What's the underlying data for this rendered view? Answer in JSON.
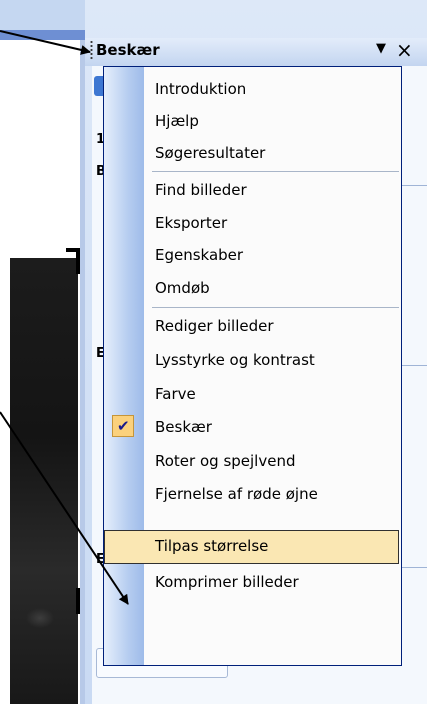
{
  "pane": {
    "title": "Beskær",
    "dropdown_icon": "dropdown-triangle-icon",
    "close_icon": "close-icon",
    "close_glyph": "×",
    "dropdown_glyph": "▼",
    "stub_letters": [
      "1",
      "B",
      "E",
      "E"
    ]
  },
  "menu": {
    "items": [
      {
        "label": "Introduktion",
        "checked": false,
        "highlighted": false
      },
      {
        "label": "Hjælp",
        "checked": false,
        "highlighted": false
      },
      {
        "label": "Søgeresultater",
        "checked": false,
        "highlighted": false
      },
      {
        "label": "Find billeder",
        "checked": false,
        "highlighted": false
      },
      {
        "label": "Eksporter",
        "checked": false,
        "highlighted": false
      },
      {
        "label": "Egenskaber",
        "checked": false,
        "highlighted": false
      },
      {
        "label": "Omdøb",
        "checked": false,
        "highlighted": false
      },
      {
        "label": "Rediger billeder",
        "checked": false,
        "highlighted": false
      },
      {
        "label": "Lysstyrke og kontrast",
        "checked": false,
        "highlighted": false
      },
      {
        "label": "Farve",
        "checked": false,
        "highlighted": false
      },
      {
        "label": "Beskær",
        "checked": true,
        "highlighted": false
      },
      {
        "label": "Roter og spejlvend",
        "checked": false,
        "highlighted": false
      },
      {
        "label": "Fjernelse af røde øjne",
        "checked": false,
        "highlighted": false
      },
      {
        "label": "Tilpas størrelse",
        "checked": false,
        "highlighted": true
      },
      {
        "label": "Komprimer billeder",
        "checked": false,
        "highlighted": false
      }
    ],
    "check_glyph": "✔",
    "check_icon": "checkmark-icon"
  },
  "colors": {
    "highlight": "#fae7b3",
    "checked_bg": "#fbd17c",
    "pane_bg": "#c9daf3"
  }
}
